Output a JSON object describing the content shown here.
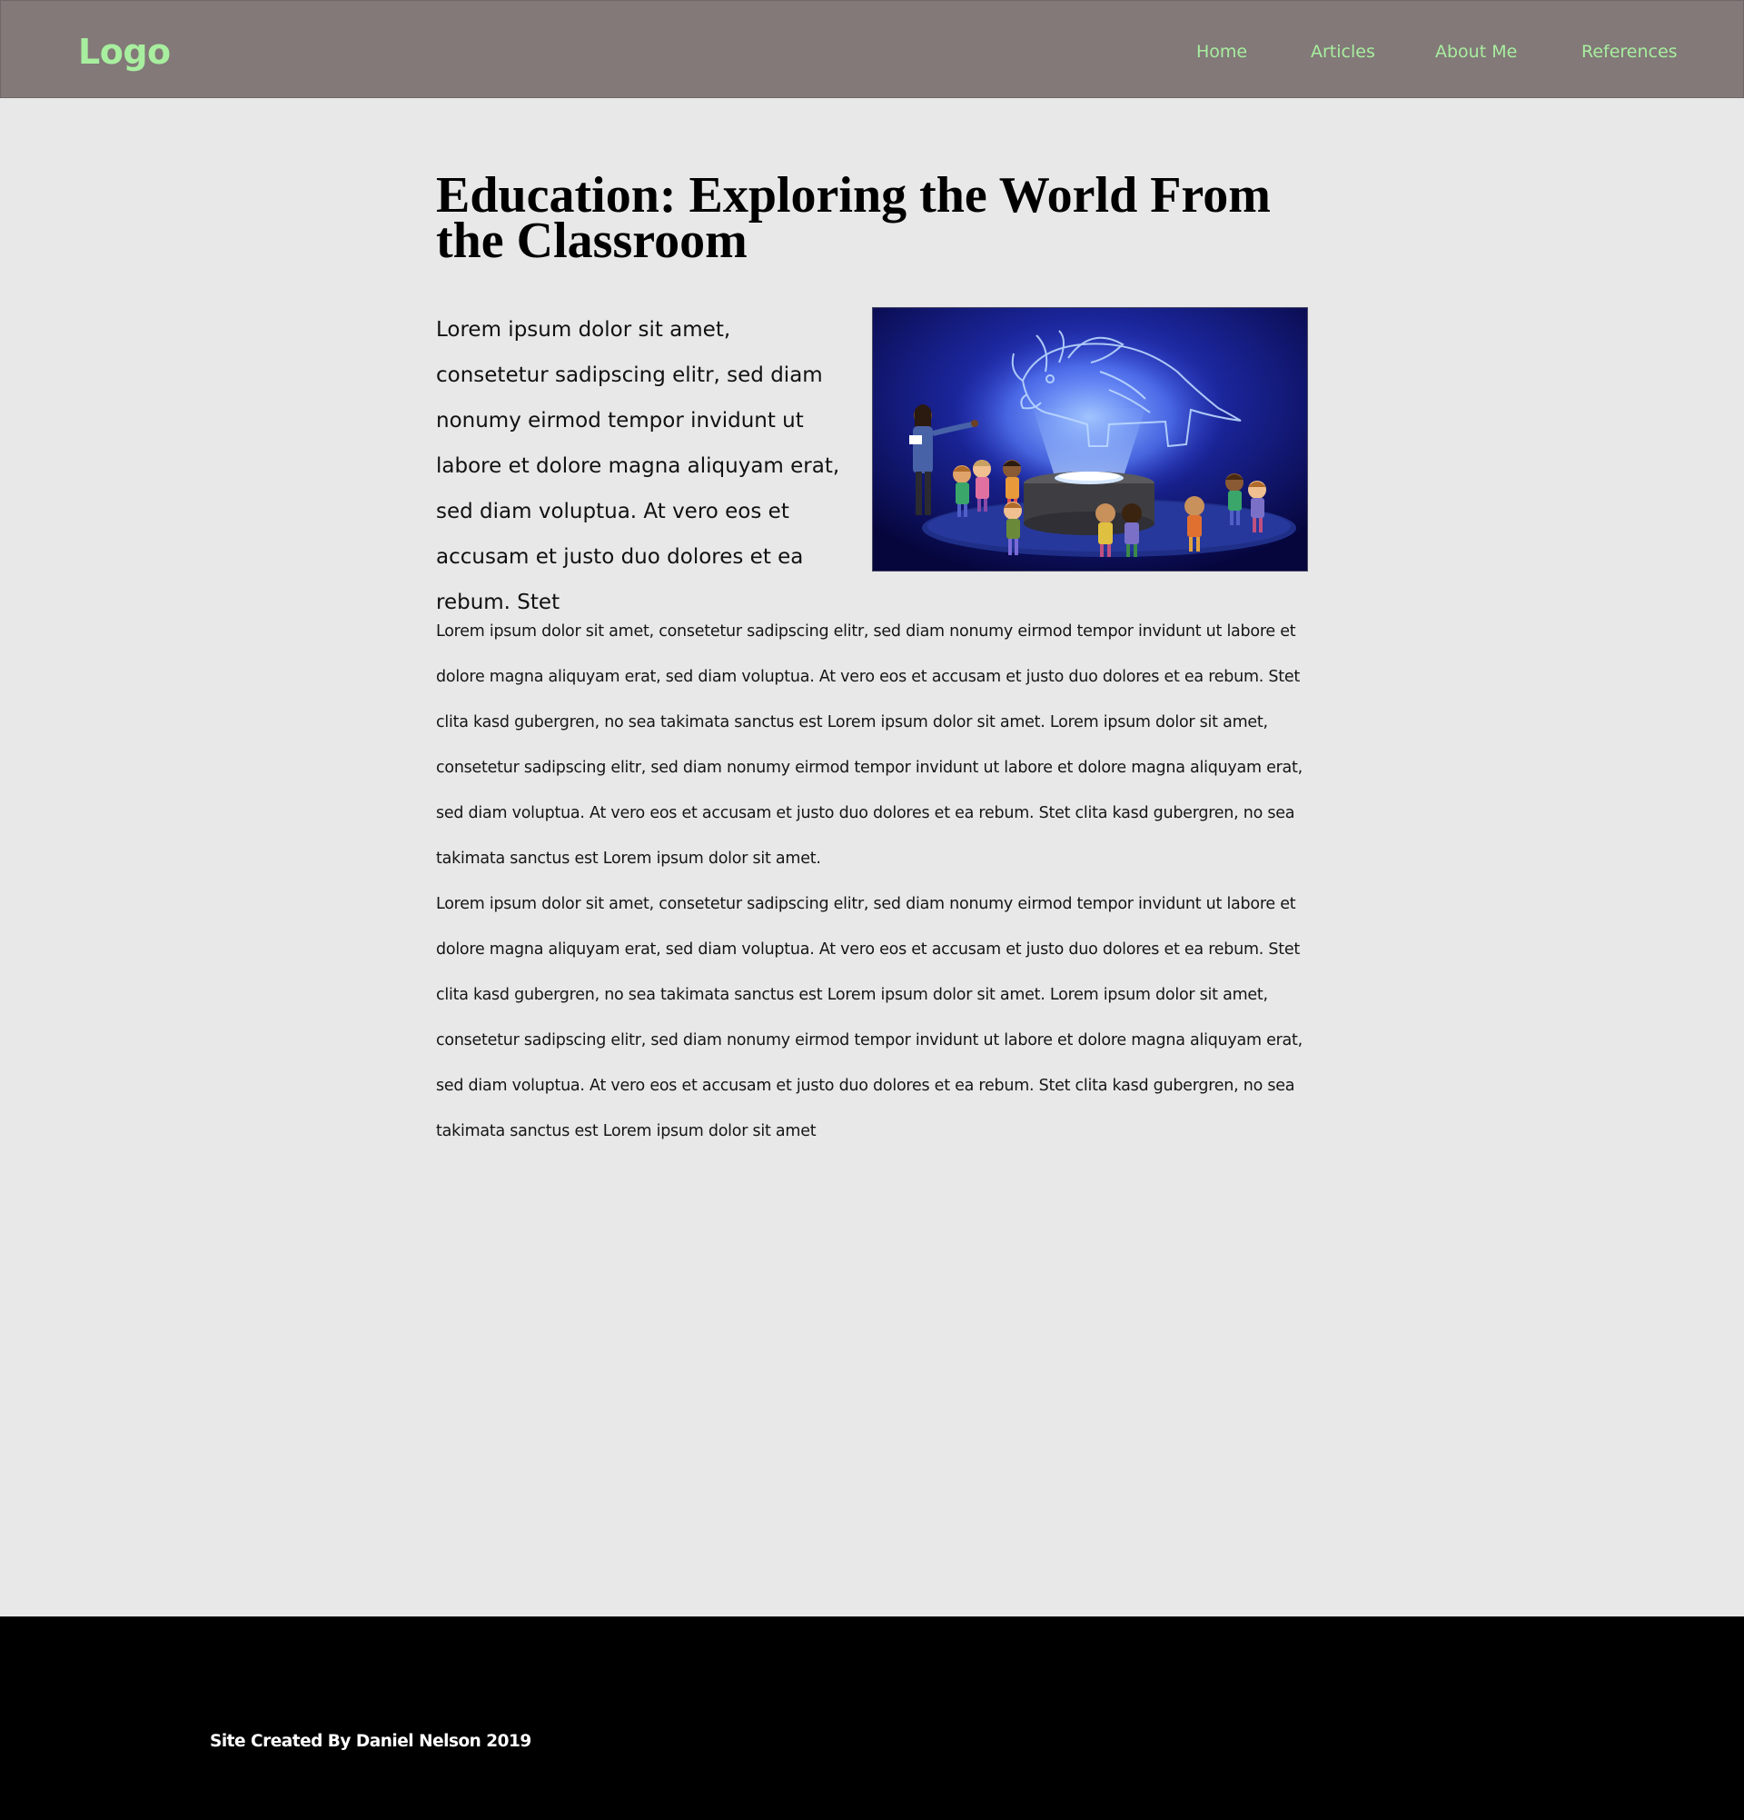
{
  "header": {
    "logo": "Logo",
    "nav": [
      {
        "label": "Home"
      },
      {
        "label": "Articles"
      },
      {
        "label": "About Me"
      },
      {
        "label": "References"
      }
    ],
    "colors": {
      "background": "#827978",
      "accent": "#a8ee9f"
    }
  },
  "article": {
    "title": "Education: Exploring the World From the Classroom",
    "intro": "Lorem ipsum dolor sit amet, consetetur sadipscing elitr, sed diam nonumy eirmod tempor invidunt ut labore et dolore magna aliquyam erat, sed diam voluptua. At vero eos et accusam et justo duo dolores et ea rebum. Stet",
    "image": "classroom-hologram-illustration",
    "paragraphs": [
      "Lorem ipsum dolor sit amet, consetetur sadipscing elitr, sed diam nonumy eirmod tempor invidunt ut labore et dolore magna aliquyam erat, sed diam voluptua. At vero eos et accusam et justo duo dolores et ea rebum. Stet clita kasd gubergren, no sea takimata sanctus est Lorem ipsum dolor sit amet. Lorem ipsum dolor sit amet, consetetur sadipscing elitr, sed diam nonumy eirmod tempor invidunt ut labore et dolore magna aliquyam erat, sed diam voluptua. At vero eos et accusam et justo duo dolores et ea rebum. Stet clita kasd gubergren, no sea takimata sanctus est Lorem ipsum dolor sit amet.",
      "Lorem ipsum dolor sit amet, consetetur sadipscing elitr, sed diam nonumy eirmod tempor invidunt ut labore et dolore magna aliquyam erat, sed diam voluptua. At vero eos et accusam et justo duo dolores et ea rebum. Stet clita kasd gubergren, no sea takimata sanctus est Lorem ipsum dolor sit amet. Lorem ipsum dolor sit amet, consetetur sadipscing elitr, sed diam nonumy eirmod tempor invidunt ut labore et dolore magna aliquyam erat, sed diam voluptua. At vero eos et accusam et justo duo dolores et ea rebum. Stet clita kasd gubergren, no sea takimata sanctus est Lorem ipsum dolor sit amet"
    ]
  },
  "footer": {
    "text": "Site Created By Daniel Nelson 2019"
  }
}
